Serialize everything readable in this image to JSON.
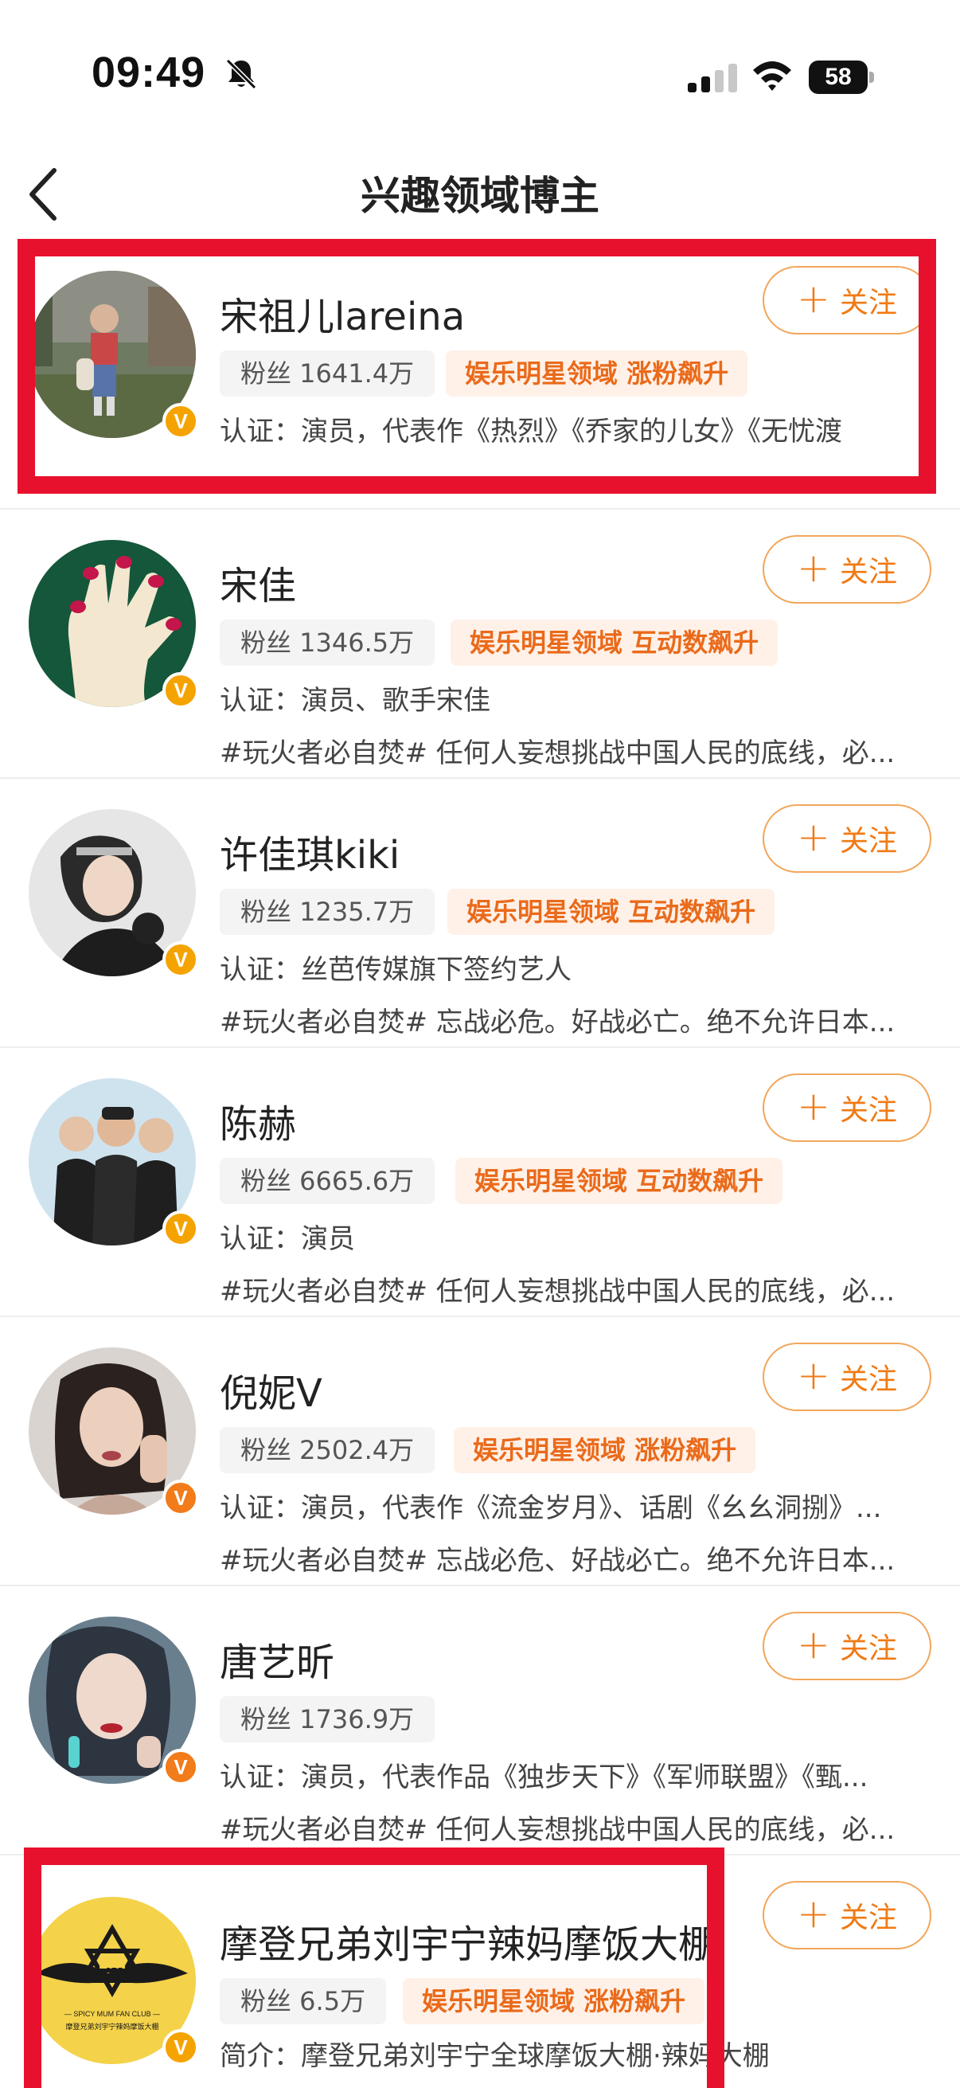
{
  "status_bar": {
    "time": "09:49",
    "battery": "58",
    "icons": [
      "bell-slash-icon",
      "signal-icon",
      "wifi-icon",
      "battery-icon"
    ]
  },
  "nav": {
    "title": "兴趣领域博主",
    "back_icon": "chevron-left-icon"
  },
  "follow_label": "关注",
  "users": [
    {
      "name": "宋祖儿lareina",
      "fans": "粉丝 1641.4万",
      "tag": "娱乐明星领域 涨粉飙升",
      "line1": "认证：演员，代表作《热烈》《乔家的儿女》《无忧渡",
      "line2": ""
    },
    {
      "name": "宋佳",
      "fans": "粉丝 1346.5万",
      "tag": "娱乐明星领域 互动数飙升",
      "line1": "认证：演员、歌手宋佳",
      "line2": "#玩火者必自焚# 任何人妄想挑战中国人民的底线，必..."
    },
    {
      "name": "许佳琪kiki",
      "fans": "粉丝 1235.7万",
      "tag": "娱乐明星领域 互动数飙升",
      "line1": "认证：丝芭传媒旗下签约艺人",
      "line2": "#玩火者必自焚# 忘战必危。好战必亡。绝不允许日本..."
    },
    {
      "name": "陈赫",
      "fans": "粉丝 6665.6万",
      "tag": "娱乐明星领域 互动数飙升",
      "line1": "认证：演员",
      "line2": "#玩火者必自焚# 任何人妄想挑战中国人民的底线，必..."
    },
    {
      "name": "倪妮V",
      "fans": "粉丝 2502.4万",
      "tag": "娱乐明星领域 涨粉飙升",
      "line1": "认证：演员，代表作《流金岁月》、话剧《幺幺洞捌》...",
      "line2": "#玩火者必自焚# 忘战必危、好战必亡。绝不允许日本..."
    },
    {
      "name": "唐艺昕",
      "fans": "粉丝 1736.9万",
      "tag": "",
      "line1": "认证：演员，代表作品《独步天下》《军师联盟》《甄...",
      "line2": "#玩火者必自焚# 任何人妄想挑战中国人民的底线，必..."
    },
    {
      "name": "摩登兄弟刘宇宁辣妈摩饭大棚",
      "fans": "粉丝 6.5万",
      "tag": "娱乐明星领域 涨粉飙升",
      "line1": "简介：摩登兄弟刘宇宁全球摩饭大棚·辣妈大棚",
      "line2": "",
      "avatar_text": {
        "logo": "LYN",
        "club": "— SPICY MUM FAN CLUB —",
        "sub": "摩登兄弟刘宇宁辣妈摩饭大棚"
      }
    }
  ],
  "colors": {
    "accent": "#f07a14",
    "tag_bg": "#fff1e8",
    "highlight": "#e8112d",
    "verified": "#f5a300"
  }
}
